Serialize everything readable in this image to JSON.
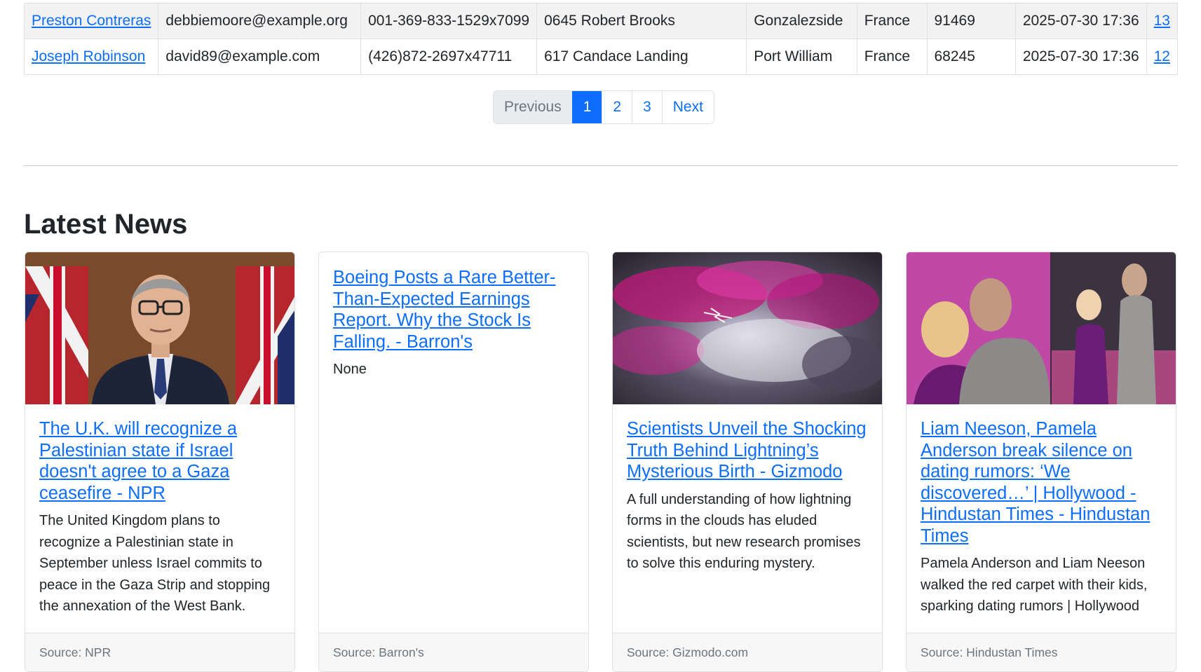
{
  "table": {
    "rows": [
      {
        "name": "Preston Contreras",
        "email": "debbiemoore@example.org",
        "phone": "001-369-833-1529x7099",
        "address": "0645 Robert Brooks",
        "city": "Gonzalezside",
        "country": "France",
        "zip": "91469",
        "date": "2025-07-30 17:36",
        "id": "13"
      },
      {
        "name": "Joseph Robinson",
        "email": "david89@example.com",
        "phone": "(426)872-2697x47711",
        "address": "617 Candace Landing",
        "city": "Port William",
        "country": "France",
        "zip": "68245",
        "date": "2025-07-30 17:36",
        "id": "12"
      }
    ]
  },
  "pagination": {
    "previous": "Previous",
    "pages": [
      "1",
      "2",
      "3"
    ],
    "active_page": "1",
    "next": "Next"
  },
  "news": {
    "heading": "Latest News",
    "cards": [
      {
        "title": "The U.K. will recognize a Palestinian state if Israel doesn't agree to a Gaza ceasefire - NPR",
        "description": "The United Kingdom plans to recognize a Palestinian state in September unless Israel commits to peace in the Gaza Strip and stopping the annexation of the West Bank.",
        "source": "Source: NPR",
        "image": "press-briefing-photo"
      },
      {
        "title": "Boeing Posts a Rare Better-Than-Expected Earnings Report. Why the Stock Is Falling. - Barron's",
        "description": "None",
        "source": "Source: Barron's",
        "image": ""
      },
      {
        "title": "Scientists Unveil the Shocking Truth Behind Lightning’s Mysterious Birth - Gizmodo",
        "description": "A full understanding of how lightning forms in the clouds has eluded scientists, but new research promises to solve this enduring mystery.",
        "source": "Source: Gizmodo.com",
        "image": "pink-storm-clouds-photo"
      },
      {
        "title": "Liam Neeson, Pamela Anderson break silence on dating rumors: ‘We discovered…’ | Hollywood - Hindustan Times - Hindustan Times",
        "description": "Pamela Anderson and Liam Neeson walked the red carpet with their kids, sparking dating rumors | Hollywood",
        "source": "Source: Hindustan Times",
        "image": "red-carpet-photo"
      }
    ]
  },
  "colors": {
    "link": "#0d6efd",
    "active_page_bg": "#0d6efd",
    "striped_row": "#f2f2f2",
    "card_footer_bg": "#f7f7f7"
  }
}
